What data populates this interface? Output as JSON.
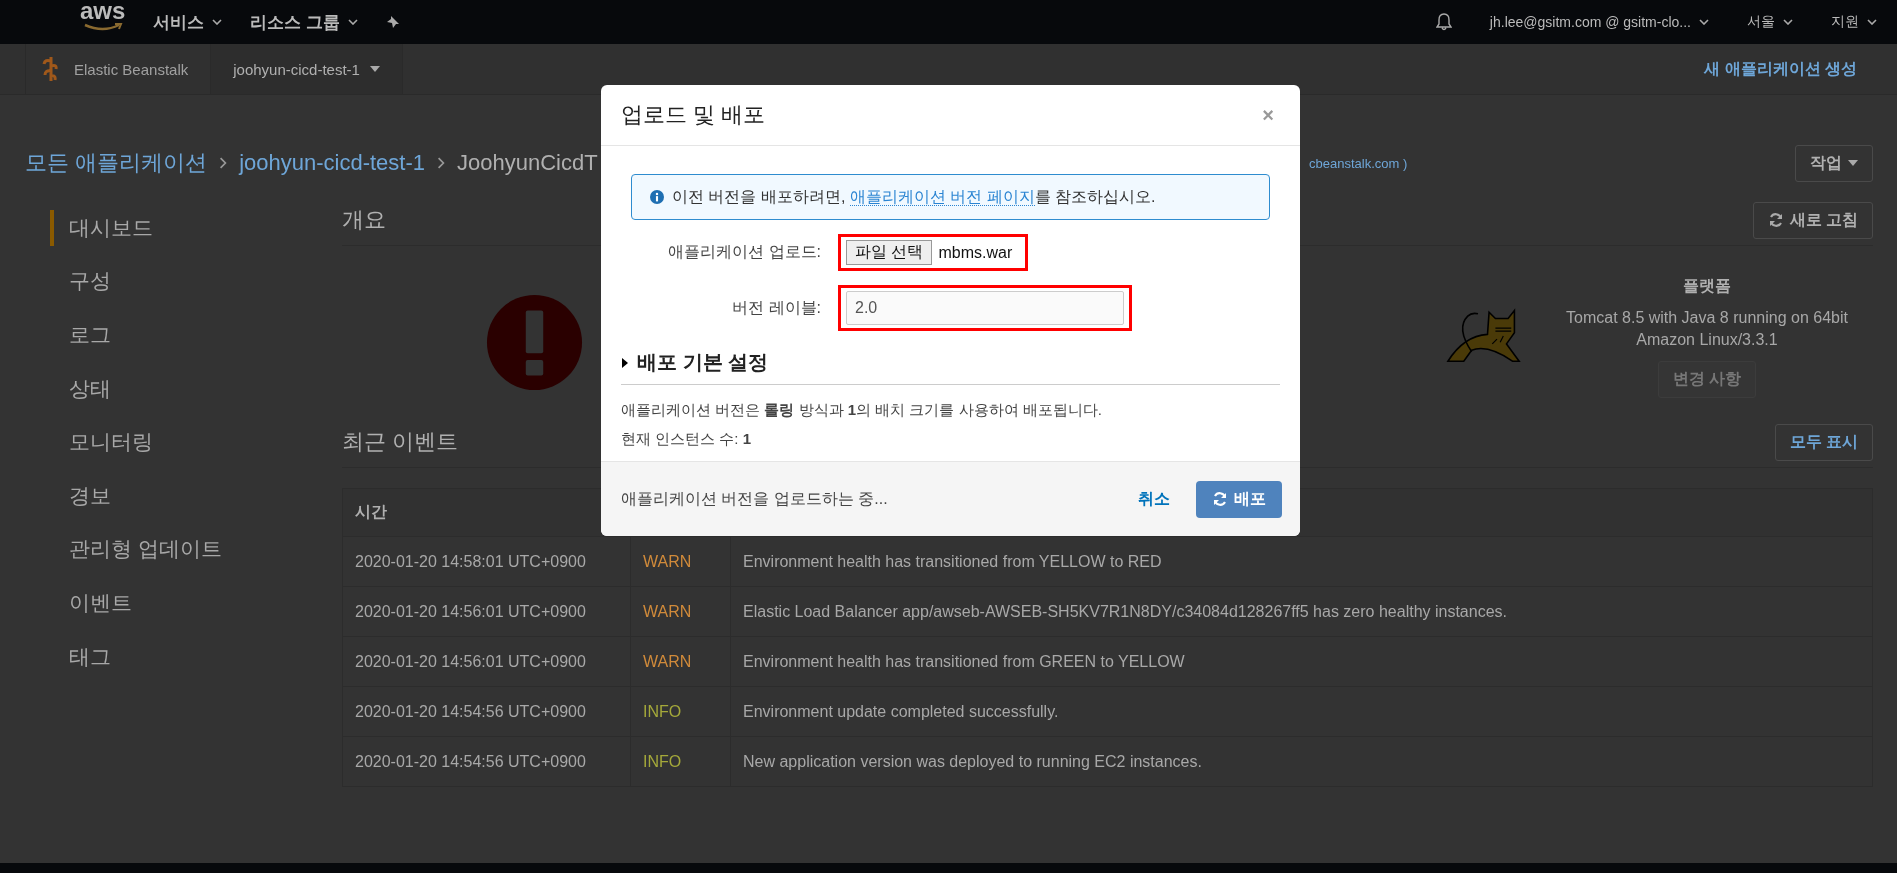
{
  "top_nav": {
    "logo": "aws",
    "menus": [
      {
        "label": "서비스"
      },
      {
        "label": "리소스 그룹"
      }
    ],
    "account": "jh.lee@gsitm.com @ gsitm-clo...",
    "region": "서울",
    "support": "지원"
  },
  "sub_nav": {
    "service": "Elastic Beanstalk",
    "application": "joohyun-cicd-test-1",
    "create_link": "새 애플리케이션 생성"
  },
  "breadcrumb": {
    "items": [
      "모든 애플리케이션",
      "joohyun-cicd-test-1"
    ],
    "current": "JoohyunCicdT",
    "url_fragment": "cbeanstalk.com )"
  },
  "actions_button": "작업",
  "sidebar": {
    "items": [
      {
        "label": "대시보드",
        "selected": true
      },
      {
        "label": "구성",
        "selected": false
      },
      {
        "label": "로그",
        "selected": false
      },
      {
        "label": "상태",
        "selected": false
      },
      {
        "label": "모니터링",
        "selected": false
      },
      {
        "label": "경보",
        "selected": false
      },
      {
        "label": "관리형 업데이트",
        "selected": false
      },
      {
        "label": "이벤트",
        "selected": false
      },
      {
        "label": "태그",
        "selected": false
      }
    ]
  },
  "overview": {
    "title": "개요",
    "refresh_button": "새로 고침",
    "platform": {
      "title": "플랫폼",
      "description": "Tomcat 8.5 with Java 8 running on 64bit Amazon Linux/3.3.1",
      "changes_button": "변경 사항",
      "changes_disabled": true
    }
  },
  "events": {
    "title": "최근 이벤트",
    "show_all_button": "모두 표시",
    "columns": [
      "시간"
    ],
    "rows": [
      {
        "time": "2020-01-20 14:58:01 UTC+0900",
        "kind": "warn",
        "type": "WARN",
        "message": "Environment health has transitioned from YELLOW to RED"
      },
      {
        "time": "2020-01-20 14:56:01 UTC+0900",
        "kind": "warn",
        "type": "WARN",
        "message": "Elastic Load Balancer app/awseb-AWSEB-SH5KV7R1N8DY/c34084d128267ff5 has zero healthy instances."
      },
      {
        "time": "2020-01-20 14:56:01 UTC+0900",
        "kind": "warn",
        "type": "WARN",
        "message": "Environment health has transitioned from GREEN to YELLOW"
      },
      {
        "time": "2020-01-20 14:54:56 UTC+0900",
        "kind": "info",
        "type": "INFO",
        "message": "Environment update completed successfully."
      },
      {
        "time": "2020-01-20 14:54:56 UTC+0900",
        "kind": "info",
        "type": "INFO",
        "message": "New application version was deployed to running EC2 instances."
      }
    ]
  },
  "modal": {
    "title": "업로드 및 배포",
    "close": "×",
    "info": {
      "before": "이전 버전을 배포하려면, ",
      "link": "애플리케이션 버전 페이지",
      "after": "를 참조하십시오."
    },
    "upload": {
      "label": "애플리케이션 업로드:",
      "button": "파일 선택",
      "file_name": "mbms.war",
      "highlighted": true
    },
    "version": {
      "label": "버전 레이블:",
      "value": "2.0",
      "highlighted": true
    },
    "settings": {
      "title": "배포 기본 설정",
      "expanded": false
    },
    "deploy_note": "애플리케이션 버전은 **롤링** 방식과 **1**의 배치 크기를 사용하여 배포됩니다.",
    "instances_note": "현재 인스턴스 수: **1**",
    "status": "애플리케이션 버전을 업로드하는 중...",
    "cancel": "취소",
    "deploy": "배포"
  }
}
